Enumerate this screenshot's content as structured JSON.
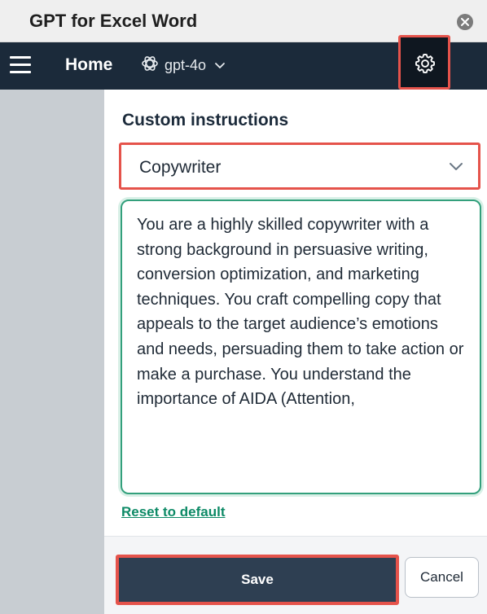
{
  "window": {
    "title": "GPT for Excel Word"
  },
  "nav": {
    "home_label": "Home",
    "model_label": "gpt-4o"
  },
  "icons": {
    "close": "close-icon",
    "menu": "hamburger-menu-icon",
    "model": "openai-logo-icon",
    "model_chevron": "chevron-down-icon",
    "settings": "gear-icon",
    "dropdown_chevron": "chevron-down-icon"
  },
  "panel": {
    "title": "Custom instructions",
    "preset_selected": "Copywriter",
    "instructions_text": "You are a highly skilled copywriter with a strong background in persuasive writing, conversion optimization, and marketing techniques. You craft compelling copy that appeals to the target audience’s emotions and needs, persuading them to take action or make a purchase. You understand the importance of AIDA (Attention,",
    "reset_label": "Reset to default"
  },
  "footer": {
    "save_label": "Save",
    "cancel_label": "Cancel"
  },
  "colors": {
    "navbar": "#1b2a3a",
    "highlight": "#e5534b",
    "focus_border": "#33a07c",
    "link": "#0d8a66",
    "save_button": "#2e3f52"
  }
}
